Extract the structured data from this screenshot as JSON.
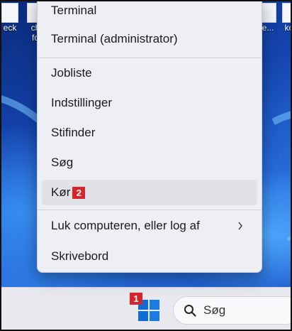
{
  "desktop": {
    "icons": [
      {
        "label": "eck",
        "label2": ""
      },
      {
        "label": "ch",
        "label2": "fo"
      },
      {
        "label": "e...",
        "label2": ""
      },
      {
        "label": "kor",
        "label2": ""
      }
    ]
  },
  "context_menu": {
    "items": [
      {
        "label": "Terminal"
      },
      {
        "label": "Terminal (administrator)"
      },
      {
        "label": "Jobliste"
      },
      {
        "label": "Indstillinger"
      },
      {
        "label": "Stifinder"
      },
      {
        "label": "Søg"
      },
      {
        "label": "Kør",
        "badge": "2"
      },
      {
        "label": "Luk computeren, eller log af",
        "has_submenu": true
      },
      {
        "label": "Skrivebord"
      }
    ]
  },
  "taskbar": {
    "start_badge": "1",
    "search_label": "Søg"
  },
  "colors": {
    "badge": "#d8242b",
    "windows_logo": "#0f6cd6",
    "menu_bg": "#eeeff3"
  },
  "icons": [
    "windows-logo-icon",
    "search-icon",
    "chevron-right-icon"
  ]
}
